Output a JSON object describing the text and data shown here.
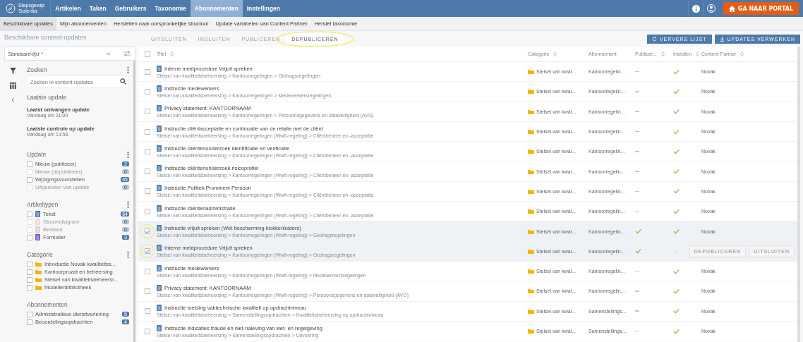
{
  "brand": {
    "line1": "Stapsgewijs",
    "line2": "Scienta"
  },
  "nav": [
    {
      "label": "Artikelen",
      "selected": false
    },
    {
      "label": "Taken",
      "selected": false
    },
    {
      "label": "Gebruikers",
      "selected": false
    },
    {
      "label": "Taxonomie",
      "selected": false
    },
    {
      "label": "Abonnementen",
      "selected": true
    },
    {
      "label": "Instellingen",
      "selected": false
    }
  ],
  "portal_button": "GA NAAR PORTAL",
  "subnav": [
    {
      "label": "Beschikbare updates",
      "selected": true
    },
    {
      "label": "Mijn abonnementen",
      "selected": false
    },
    {
      "label": "Herstellen naar oorspronkelijke structuur",
      "selected": false
    },
    {
      "label": "Update variabelen van Content Partner",
      "selected": false
    },
    {
      "label": "Herstel taxonomie",
      "selected": false
    }
  ],
  "page_title": "Beschikbare content-updates",
  "action_tabs": [
    {
      "label": "UITSLUITEN",
      "selected": false,
      "highlighted": false
    },
    {
      "label": "INSLUITEN",
      "selected": false,
      "highlighted": false
    },
    {
      "label": "PUBLICEREN",
      "selected": false,
      "highlighted": false
    },
    {
      "label": "DEPUBLICEREN",
      "selected": true,
      "highlighted": true
    }
  ],
  "toolbar_buttons": [
    "VERVERS LIJST",
    "UPDATES VERWERKEN"
  ],
  "sidebar": {
    "view_select": "Standaard-lijst *",
    "search": {
      "title": "Zoeken",
      "placeholder": "Zoeken in content-updates"
    },
    "last_update": {
      "title": "Laatste update",
      "items": [
        {
          "label": "Laatst ontvangen update",
          "value": "Vandaag om 11:00"
        },
        {
          "label": "Laatste controle op update",
          "value": "Vandaag om 13:58"
        }
      ]
    },
    "groups": [
      {
        "title": "Update",
        "menu": true,
        "items": [
          {
            "label": "Nieuw (publiceer)",
            "count": "2",
            "checked": false,
            "disabled": false
          },
          {
            "label": "Nieuw (depubliceer)",
            "count": "0",
            "checked": false,
            "disabled": true
          },
          {
            "label": "Wijzigingsvoorstellen",
            "count": "65",
            "checked": false,
            "disabled": false
          },
          {
            "label": "Uitgesloten van update",
            "count": "0",
            "checked": false,
            "disabled": true
          }
        ]
      },
      {
        "title": "Artikeltypen",
        "menu": true,
        "items": [
          {
            "label": "Tekst",
            "count": "64",
            "checked": false,
            "disabled": false,
            "kind": "text"
          },
          {
            "label": "Stroomdiagram",
            "count": "0",
            "checked": false,
            "disabled": true,
            "kind": "flow"
          },
          {
            "label": "Bestand",
            "count": "0",
            "checked": false,
            "disabled": true,
            "kind": "file"
          },
          {
            "label": "Formulier",
            "count": "3",
            "checked": false,
            "disabled": false,
            "kind": "form"
          }
        ]
      },
      {
        "title": "Categorie",
        "menu": true,
        "items": [
          {
            "label": "Introductie Novak kwaliteitss...",
            "checked": false,
            "disabled": false,
            "kind": "folder"
          },
          {
            "label": "Kantoorprozat en beheersing",
            "checked": false,
            "disabled": false,
            "kind": "folder"
          },
          {
            "label": "Stelsel van kwaliteitsbeheersi...",
            "checked": false,
            "disabled": false,
            "kind": "folder"
          },
          {
            "label": "Modellenbibliotheek",
            "checked": false,
            "disabled": false,
            "kind": "folder"
          }
        ]
      },
      {
        "title": "Abonnementen",
        "menu": false,
        "items": [
          {
            "label": "Administratieve dienstverlening",
            "count": "5",
            "checked": false,
            "disabled": false
          },
          {
            "label": "Beoordelingsopdrachten",
            "count": "4",
            "checked": false,
            "disabled": false
          }
        ]
      }
    ]
  },
  "table": {
    "select_all_checked": false,
    "columns": [
      "Titel",
      "Categorie",
      "Abonnement",
      "Publicer...",
      "Insluiten",
      "Content Partner"
    ],
    "rows": [
      {
        "title": "Interne meldprocedure Vrijuit spreken",
        "path": "Stelsel van kwaliteitsbeheersing > Kantoorregelingen > Gedragsregelingen",
        "category": "Stelsel van kwal...",
        "subscription": "Kantoorregelin...",
        "publish": false,
        "include": true,
        "partner": "Novak",
        "checked": false,
        "highlighted": false
      },
      {
        "title": "Instructie medewerkers",
        "path": "Stelsel van kwaliteitsbeheersing > Kantoorregelingen > Medewerkersregelingen",
        "category": "Stelsel van kwal...",
        "subscription": "Kantoorregelin...",
        "publish": false,
        "include": true,
        "partner": "Novak",
        "checked": false,
        "highlighted": false
      },
      {
        "title": "Privacy statement: KANTOORNAAM",
        "path": "Stelsel van kwaliteitsbeheersing > Kantoorregelingen > Persoonsgegevens en dataveiligheid (AVG)",
        "category": "Stelsel van kwal...",
        "subscription": "Kantoorregelin...",
        "publish": false,
        "include": true,
        "partner": "Novak",
        "checked": false,
        "highlighted": false
      },
      {
        "title": "Instructie cliëntacceptatie en continuatie van de relatie met de cliënt",
        "path": "Stelsel van kwaliteitsbeheersing > Kantoorregelingen (Wwft-regeling) > Cliëntbeheer en -acceptatie",
        "category": "Stelsel van kwal...",
        "subscription": "Kantoorregelin...",
        "publish": false,
        "include": true,
        "partner": "Novak",
        "checked": false,
        "highlighted": false
      },
      {
        "title": "Instructie cliëntenonderzoek identificatie en verificatie",
        "path": "Stelsel van kwaliteitsbeheersing > Kantoorregelingen (Wwft-regeling) > Cliëntbeheer en -acceptatie",
        "category": "Stelsel van kwal...",
        "subscription": "Kantoorregelin...",
        "publish": false,
        "include": true,
        "partner": "Novak",
        "checked": false,
        "highlighted": false
      },
      {
        "title": "Instructie cliëntenonderzoek risicoprofiel",
        "path": "Stelsel van kwaliteitsbeheersing > Kantoorregelingen (Wwft-regeling) > Cliëntbeheer en -acceptatie",
        "category": "Stelsel van kwal...",
        "subscription": "Kantoorregelin...",
        "publish": false,
        "include": true,
        "partner": "Novak",
        "checked": false,
        "highlighted": false
      },
      {
        "title": "Instructie Politiek Prominent Persoon",
        "path": "Stelsel van kwaliteitsbeheersing > Kantoorregelingen (Wwft-regeling) > Cliëntbeheer en -acceptatie",
        "category": "Stelsel van kwal...",
        "subscription": "Kantoorregelin...",
        "publish": false,
        "include": true,
        "partner": "Novak",
        "checked": false,
        "highlighted": false
      },
      {
        "title": "Instructie cliëntenadministratie",
        "path": "Stelsel van kwaliteitsbeheersing > Kantoorregelingen (Wwft-regeling) > Cliëntbeheer en -acceptatie",
        "category": "Stelsel van kwal...",
        "subscription": "Kantoorregelin...",
        "publish": false,
        "include": true,
        "partner": "Novak",
        "checked": false,
        "highlighted": false
      },
      {
        "title": "Instructie vrijuit spreken (Wet bescherming klokkenluiders)",
        "path": "Stelsel van kwaliteitsbeheersing > Kantoorregelingen (Wwft-regeling) > Gedragsregelingen",
        "category": "Stelsel van kwal...",
        "subscription": "Kantoorregelin...",
        "publish": true,
        "include": true,
        "partner": "Novak",
        "checked": true,
        "highlighted": true
      },
      {
        "title": "Interne meldprocedure Vrijuit spreken",
        "path": "Stelsel van kwaliteitsbeheersing > Kantoorregelingen (Wwft-regeling) > Gedragsregelingen",
        "category": "Stelsel van kwal...",
        "subscription": "Kantoorregelin...",
        "publish": true,
        "include": false,
        "actions": [
          "DEPUBLICEREN",
          "UITSLUITEN"
        ],
        "checked": true,
        "highlighted": true
      },
      {
        "title": "Instructie medewerkers",
        "path": "Stelsel van kwaliteitsbeheersing > Kantoorregelingen (Wwft-regeling) > Medewerkersregelingen",
        "category": "Stelsel van kwal...",
        "subscription": "Kantoorregelin...",
        "publish": false,
        "include": true,
        "partner": "Novak",
        "checked": false,
        "highlighted": false
      },
      {
        "title": "Privacy statement: KANTOORNAAM",
        "path": "Stelsel van kwaliteitsbeheersing > Kantoorregelingen (Wwft-regeling) > Persoonsgegevens en dataveiligheid (AVG)",
        "category": "Stelsel van kwal...",
        "subscription": "Kantoorregelin...",
        "publish": false,
        "include": true,
        "partner": "Novak",
        "checked": false,
        "highlighted": false
      },
      {
        "title": "Instructie toetsing vaktechnische kwaliteit op opdrachtniveau",
        "path": "Stelsel van kwaliteitsbeheersing > Samenstellingsopdrachten > Kwaliteitsbeheersing op opdrachtniveau",
        "category": "Stelsel van kwal...",
        "subscription": "Samenstellings...",
        "publish": false,
        "include": true,
        "partner": "Novak",
        "checked": false,
        "highlighted": false
      },
      {
        "title": "Instructie indicaties fraude en niet-naleving van wet- en regelgeving",
        "path": "Stelsel van kwaliteitsbeheersing > Samenstellingsopdrachten > Uitvoering",
        "category": "Stelsel van kwal...",
        "subscription": "Samenstellings...",
        "publish": false,
        "include": true,
        "partner": "Novak",
        "checked": false,
        "highlighted": false
      }
    ]
  }
}
